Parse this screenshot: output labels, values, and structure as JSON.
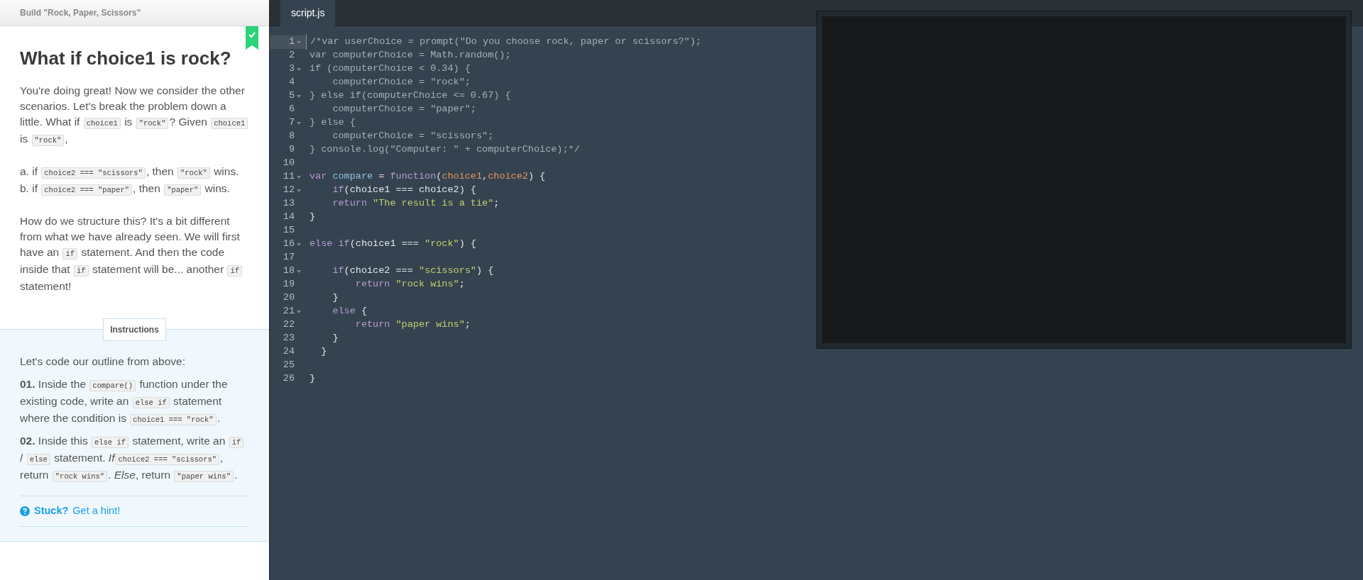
{
  "lesson": {
    "course_title": "Build \"Rock, Paper, Scissors\"",
    "completed": true,
    "heading": "What if choice1 is rock?",
    "paragraphs": [
      [
        {
          "kind": "text",
          "text": "You're doing great! Now we consider the other scenarios. Let's break the problem down a little. What if "
        },
        {
          "kind": "code",
          "text": "choice1"
        },
        {
          "kind": "text",
          "text": " is "
        },
        {
          "kind": "code",
          "text": "\"rock\""
        },
        {
          "kind": "text",
          "text": "? Given "
        },
        {
          "kind": "code",
          "text": "choice1"
        },
        {
          "kind": "text",
          "text": " is "
        },
        {
          "kind": "code",
          "text": "\"rock\""
        },
        {
          "kind": "text",
          "text": ","
        }
      ],
      [
        {
          "kind": "text",
          "text": "a. if "
        },
        {
          "kind": "code",
          "text": "choice2 === \"scissors\""
        },
        {
          "kind": "text",
          "text": ", then "
        },
        {
          "kind": "code",
          "text": "\"rock\""
        },
        {
          "kind": "text",
          "text": " wins."
        }
      ],
      [
        {
          "kind": "text",
          "text": "b. if "
        },
        {
          "kind": "code",
          "text": "choice2 === \"paper\""
        },
        {
          "kind": "text",
          "text": ", then "
        },
        {
          "kind": "code",
          "text": "\"paper\""
        },
        {
          "kind": "text",
          "text": " wins."
        }
      ],
      [
        {
          "kind": "text",
          "text": "How do we structure this? It's a bit different from what we have already seen. We will first have an "
        },
        {
          "kind": "code",
          "text": "if"
        },
        {
          "kind": "text",
          "text": " statement. And then the code inside that "
        },
        {
          "kind": "code",
          "text": "if"
        },
        {
          "kind": "text",
          "text": " statement will be... another "
        },
        {
          "kind": "code",
          "text": "if"
        },
        {
          "kind": "text",
          "text": " statement!"
        }
      ]
    ]
  },
  "instructions": {
    "tab_label": "Instructions",
    "intro": "Let's code our outline from above:",
    "steps": [
      [
        {
          "kind": "text",
          "text": "**01.** Inside the "
        },
        {
          "kind": "code",
          "text": "compare()"
        },
        {
          "kind": "text",
          "text": " function under the existing code, write an "
        },
        {
          "kind": "code",
          "text": "else if"
        },
        {
          "kind": "text",
          "text": " statement where the condition is "
        },
        {
          "kind": "code",
          "text": "choice1 === \"rock\""
        },
        {
          "kind": "text",
          "text": "."
        }
      ],
      [
        {
          "kind": "text",
          "text": "**02.** Inside this "
        },
        {
          "kind": "code",
          "text": "else if"
        },
        {
          "kind": "text",
          "text": " statement, write an "
        },
        {
          "kind": "code",
          "text": "if"
        },
        {
          "kind": "text",
          "text": " / "
        },
        {
          "kind": "code",
          "text": "else"
        },
        {
          "kind": "text",
          "text": " statement. *If*"
        },
        {
          "kind": "code",
          "text": "choice2 === \"scissors\""
        },
        {
          "kind": "text",
          "text": ", return "
        },
        {
          "kind": "code",
          "text": "\"rock wins\""
        },
        {
          "kind": "text",
          "text": ". *Else*, return "
        },
        {
          "kind": "code",
          "text": "\"paper wins\""
        },
        {
          "kind": "text",
          "text": "."
        }
      ]
    ],
    "hint": {
      "label": "Stuck?",
      "link": "Get a hint!"
    }
  },
  "editor": {
    "tabs": [
      {
        "label": "script.js",
        "selected": true
      }
    ],
    "lines": [
      {
        "number": "1",
        "fold": true,
        "active": true,
        "tokens": [
          {
            "kind": "comment",
            "text": "/*var userChoice = prompt(\"Do you choose rock, paper or scissors?\");"
          }
        ]
      },
      {
        "number": "2",
        "fold": false,
        "active": false,
        "tokens": [
          {
            "kind": "comment",
            "text": "var computerChoice = Math.random();"
          }
        ]
      },
      {
        "number": "3",
        "fold": true,
        "active": false,
        "tokens": [
          {
            "kind": "comment",
            "text": "if (computerChoice < 0.34) {"
          }
        ]
      },
      {
        "number": "4",
        "fold": false,
        "active": false,
        "tokens": [
          {
            "kind": "comment",
            "text": "    computerChoice = \"rock\";"
          }
        ]
      },
      {
        "number": "5",
        "fold": true,
        "active": false,
        "tokens": [
          {
            "kind": "comment",
            "text": "} else if(computerChoice <= 0.67) {"
          }
        ]
      },
      {
        "number": "6",
        "fold": false,
        "active": false,
        "tokens": [
          {
            "kind": "comment",
            "text": "    computerChoice = \"paper\";"
          }
        ]
      },
      {
        "number": "7",
        "fold": true,
        "active": false,
        "tokens": [
          {
            "kind": "comment",
            "text": "} else {"
          }
        ]
      },
      {
        "number": "8",
        "fold": false,
        "active": false,
        "tokens": [
          {
            "kind": "comment",
            "text": "    computerChoice = \"scissors\";"
          }
        ]
      },
      {
        "number": "9",
        "fold": false,
        "active": false,
        "tokens": [
          {
            "kind": "comment",
            "text": "} console.log(\"Computer: \" + computerChoice);*/"
          }
        ]
      },
      {
        "number": "10",
        "fold": false,
        "active": false
      },
      {
        "number": "11",
        "fold": true,
        "active": false,
        "tokens": [
          {
            "kind": "keyword",
            "text": "var"
          },
          {
            "kind": "name",
            "text": " compare"
          },
          {
            "kind": "plain",
            "text": " = "
          },
          {
            "kind": "keyword",
            "text": "function"
          },
          {
            "kind": "plain",
            "text": "("
          },
          {
            "kind": "param",
            "text": "choice1"
          },
          {
            "kind": "plain",
            "text": ","
          },
          {
            "kind": "param",
            "text": "choice2"
          },
          {
            "kind": "plain",
            "text": ") {"
          }
        ]
      },
      {
        "number": "12",
        "fold": true,
        "active": false,
        "tokens": [
          {
            "kind": "keyword",
            "text": "    if"
          },
          {
            "kind": "plain",
            "text": "(choice1 === choice2) {"
          }
        ]
      },
      {
        "number": "13",
        "fold": false,
        "active": false,
        "tokens": [
          {
            "kind": "keyword",
            "text": "    return"
          },
          {
            "kind": "string",
            "text": " \"The result is a tie\""
          },
          {
            "kind": "plain",
            "text": ";"
          }
        ]
      },
      {
        "number": "14",
        "fold": false,
        "active": false,
        "tokens": [
          {
            "kind": "plain",
            "text": "}"
          }
        ]
      },
      {
        "number": "15",
        "fold": false,
        "active": false
      },
      {
        "number": "16",
        "fold": true,
        "active": false,
        "tokens": [
          {
            "kind": "keyword",
            "text": "else if"
          },
          {
            "kind": "plain",
            "text": "(choice1 === "
          },
          {
            "kind": "string",
            "text": "\"rock\""
          },
          {
            "kind": "plain",
            "text": ") {"
          }
        ]
      },
      {
        "number": "17",
        "fold": false,
        "active": false
      },
      {
        "number": "18",
        "fold": true,
        "active": false,
        "tokens": [
          {
            "kind": "keyword",
            "text": "    if"
          },
          {
            "kind": "plain",
            "text": "(choice2 === "
          },
          {
            "kind": "string",
            "text": "\"scissors\""
          },
          {
            "kind": "plain",
            "text": ") {"
          }
        ]
      },
      {
        "number": "19",
        "fold": false,
        "active": false,
        "tokens": [
          {
            "kind": "keyword",
            "text": "        return"
          },
          {
            "kind": "string",
            "text": " \"rock wins\""
          },
          {
            "kind": "plain",
            "text": ";"
          }
        ]
      },
      {
        "number": "20",
        "fold": false,
        "active": false,
        "tokens": [
          {
            "kind": "plain",
            "text": "    }"
          }
        ]
      },
      {
        "number": "21",
        "fold": true,
        "active": false,
        "tokens": [
          {
            "kind": "keyword",
            "text": "    else"
          },
          {
            "kind": "plain",
            "text": " {"
          }
        ]
      },
      {
        "number": "22",
        "fold": false,
        "active": false,
        "tokens": [
          {
            "kind": "keyword",
            "text": "        return"
          },
          {
            "kind": "string",
            "text": " \"paper wins\""
          },
          {
            "kind": "plain",
            "text": ";"
          }
        ]
      },
      {
        "number": "23",
        "fold": false,
        "active": false,
        "tokens": [
          {
            "kind": "plain",
            "text": "    }"
          }
        ]
      },
      {
        "number": "24",
        "fold": false,
        "active": false,
        "tokens": [
          {
            "kind": "plain",
            "text": "  }"
          }
        ]
      },
      {
        "number": "25",
        "fold": false,
        "active": false
      },
      {
        "number": "26",
        "fold": false,
        "active": false,
        "tokens": [
          {
            "kind": "plain",
            "text": "}"
          }
        ]
      }
    ]
  }
}
